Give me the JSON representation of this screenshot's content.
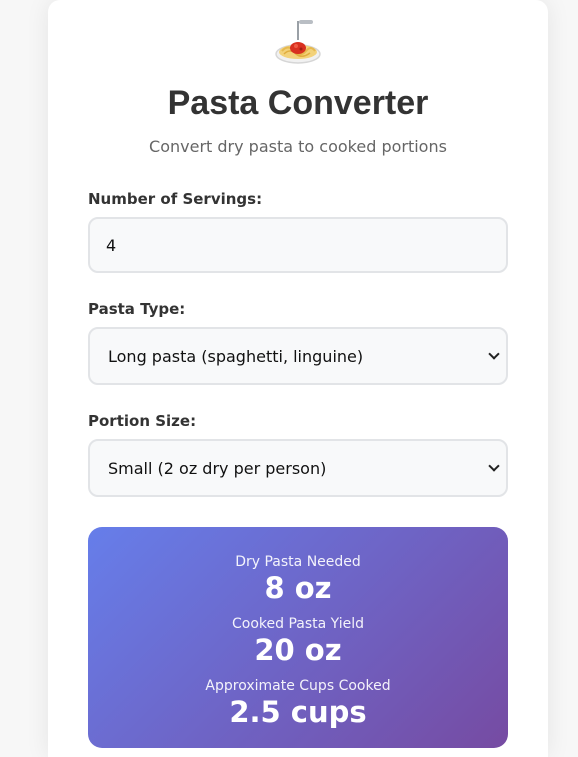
{
  "header": {
    "title": "Pasta Converter",
    "subtitle": "Convert dry pasta to cooked portions",
    "icon": "spaghetti-icon"
  },
  "form": {
    "servings": {
      "label": "Number of Servings:",
      "value": "4"
    },
    "pasta_type": {
      "label": "Pasta Type:",
      "selected": "Long pasta (spaghetti, linguine)"
    },
    "portion_size": {
      "label": "Portion Size:",
      "selected": "Small (2 oz dry per person)"
    }
  },
  "results": {
    "dry": {
      "label": "Dry Pasta Needed",
      "value": "8 oz"
    },
    "cooked": {
      "label": "Cooked Pasta Yield",
      "value": "20 oz"
    },
    "cups": {
      "label": "Approximate Cups Cooked",
      "value": "2.5 cups"
    }
  },
  "colors": {
    "gradient_start": "#667eea",
    "gradient_end": "#764ba2",
    "text_dark": "#333333"
  }
}
